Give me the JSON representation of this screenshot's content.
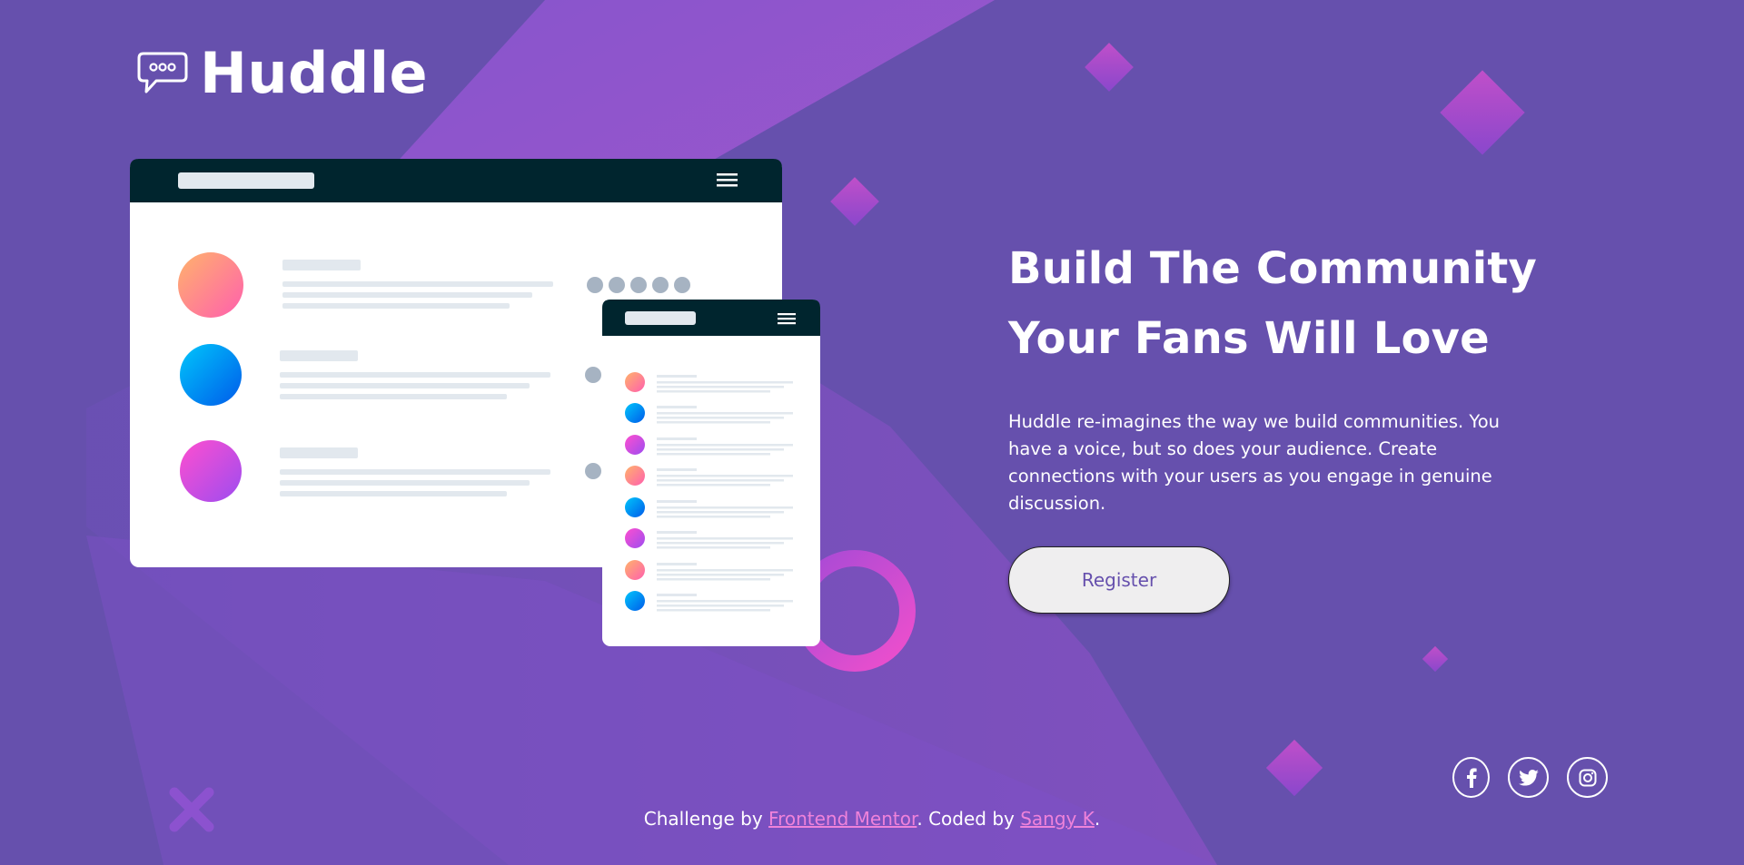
{
  "brand": {
    "name": "Huddle"
  },
  "hero": {
    "title_line1": "Build The Community",
    "title_line2": "Your Fans Will Love",
    "description": "Huddle re-imagines the way we build communities. You have a voice, but so does your audience. Create connections with your users as you engage in genuine discussion.",
    "register_label": "Register"
  },
  "social": [
    {
      "icon": "facebook-icon"
    },
    {
      "icon": "twitter-icon"
    },
    {
      "icon": "instagram-icon"
    }
  ],
  "footer": {
    "prefix": "Challenge by ",
    "challenge_link": "Frontend Mentor",
    "middle": ". Coded by ",
    "author_link": "Sangy K",
    "suffix": "."
  },
  "colors": {
    "background": "#6650ad",
    "accent_pink": "#ef82da",
    "button_bg": "#efeeef",
    "mockup_header": "#00252e"
  }
}
